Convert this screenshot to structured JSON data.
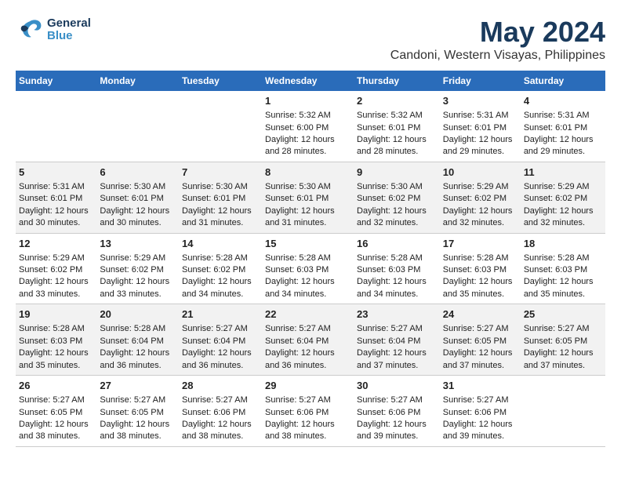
{
  "header": {
    "logo_general": "General",
    "logo_blue": "Blue",
    "main_title": "May 2024",
    "subtitle": "Candoni, Western Visayas, Philippines"
  },
  "days_of_week": [
    "Sunday",
    "Monday",
    "Tuesday",
    "Wednesday",
    "Thursday",
    "Friday",
    "Saturday"
  ],
  "weeks": [
    [
      {
        "day": "",
        "sunrise": "",
        "sunset": "",
        "daylight": ""
      },
      {
        "day": "",
        "sunrise": "",
        "sunset": "",
        "daylight": ""
      },
      {
        "day": "",
        "sunrise": "",
        "sunset": "",
        "daylight": ""
      },
      {
        "day": "1",
        "sunrise": "Sunrise: 5:32 AM",
        "sunset": "Sunset: 6:00 PM",
        "daylight": "Daylight: 12 hours and 28 minutes."
      },
      {
        "day": "2",
        "sunrise": "Sunrise: 5:32 AM",
        "sunset": "Sunset: 6:01 PM",
        "daylight": "Daylight: 12 hours and 28 minutes."
      },
      {
        "day": "3",
        "sunrise": "Sunrise: 5:31 AM",
        "sunset": "Sunset: 6:01 PM",
        "daylight": "Daylight: 12 hours and 29 minutes."
      },
      {
        "day": "4",
        "sunrise": "Sunrise: 5:31 AM",
        "sunset": "Sunset: 6:01 PM",
        "daylight": "Daylight: 12 hours and 29 minutes."
      }
    ],
    [
      {
        "day": "5",
        "sunrise": "Sunrise: 5:31 AM",
        "sunset": "Sunset: 6:01 PM",
        "daylight": "Daylight: 12 hours and 30 minutes."
      },
      {
        "day": "6",
        "sunrise": "Sunrise: 5:30 AM",
        "sunset": "Sunset: 6:01 PM",
        "daylight": "Daylight: 12 hours and 30 minutes."
      },
      {
        "day": "7",
        "sunrise": "Sunrise: 5:30 AM",
        "sunset": "Sunset: 6:01 PM",
        "daylight": "Daylight: 12 hours and 31 minutes."
      },
      {
        "day": "8",
        "sunrise": "Sunrise: 5:30 AM",
        "sunset": "Sunset: 6:01 PM",
        "daylight": "Daylight: 12 hours and 31 minutes."
      },
      {
        "day": "9",
        "sunrise": "Sunrise: 5:30 AM",
        "sunset": "Sunset: 6:02 PM",
        "daylight": "Daylight: 12 hours and 32 minutes."
      },
      {
        "day": "10",
        "sunrise": "Sunrise: 5:29 AM",
        "sunset": "Sunset: 6:02 PM",
        "daylight": "Daylight: 12 hours and 32 minutes."
      },
      {
        "day": "11",
        "sunrise": "Sunrise: 5:29 AM",
        "sunset": "Sunset: 6:02 PM",
        "daylight": "Daylight: 12 hours and 32 minutes."
      }
    ],
    [
      {
        "day": "12",
        "sunrise": "Sunrise: 5:29 AM",
        "sunset": "Sunset: 6:02 PM",
        "daylight": "Daylight: 12 hours and 33 minutes."
      },
      {
        "day": "13",
        "sunrise": "Sunrise: 5:29 AM",
        "sunset": "Sunset: 6:02 PM",
        "daylight": "Daylight: 12 hours and 33 minutes."
      },
      {
        "day": "14",
        "sunrise": "Sunrise: 5:28 AM",
        "sunset": "Sunset: 6:02 PM",
        "daylight": "Daylight: 12 hours and 34 minutes."
      },
      {
        "day": "15",
        "sunrise": "Sunrise: 5:28 AM",
        "sunset": "Sunset: 6:03 PM",
        "daylight": "Daylight: 12 hours and 34 minutes."
      },
      {
        "day": "16",
        "sunrise": "Sunrise: 5:28 AM",
        "sunset": "Sunset: 6:03 PM",
        "daylight": "Daylight: 12 hours and 34 minutes."
      },
      {
        "day": "17",
        "sunrise": "Sunrise: 5:28 AM",
        "sunset": "Sunset: 6:03 PM",
        "daylight": "Daylight: 12 hours and 35 minutes."
      },
      {
        "day": "18",
        "sunrise": "Sunrise: 5:28 AM",
        "sunset": "Sunset: 6:03 PM",
        "daylight": "Daylight: 12 hours and 35 minutes."
      }
    ],
    [
      {
        "day": "19",
        "sunrise": "Sunrise: 5:28 AM",
        "sunset": "Sunset: 6:03 PM",
        "daylight": "Daylight: 12 hours and 35 minutes."
      },
      {
        "day": "20",
        "sunrise": "Sunrise: 5:28 AM",
        "sunset": "Sunset: 6:04 PM",
        "daylight": "Daylight: 12 hours and 36 minutes."
      },
      {
        "day": "21",
        "sunrise": "Sunrise: 5:27 AM",
        "sunset": "Sunset: 6:04 PM",
        "daylight": "Daylight: 12 hours and 36 minutes."
      },
      {
        "day": "22",
        "sunrise": "Sunrise: 5:27 AM",
        "sunset": "Sunset: 6:04 PM",
        "daylight": "Daylight: 12 hours and 36 minutes."
      },
      {
        "day": "23",
        "sunrise": "Sunrise: 5:27 AM",
        "sunset": "Sunset: 6:04 PM",
        "daylight": "Daylight: 12 hours and 37 minutes."
      },
      {
        "day": "24",
        "sunrise": "Sunrise: 5:27 AM",
        "sunset": "Sunset: 6:05 PM",
        "daylight": "Daylight: 12 hours and 37 minutes."
      },
      {
        "day": "25",
        "sunrise": "Sunrise: 5:27 AM",
        "sunset": "Sunset: 6:05 PM",
        "daylight": "Daylight: 12 hours and 37 minutes."
      }
    ],
    [
      {
        "day": "26",
        "sunrise": "Sunrise: 5:27 AM",
        "sunset": "Sunset: 6:05 PM",
        "daylight": "Daylight: 12 hours and 38 minutes."
      },
      {
        "day": "27",
        "sunrise": "Sunrise: 5:27 AM",
        "sunset": "Sunset: 6:05 PM",
        "daylight": "Daylight: 12 hours and 38 minutes."
      },
      {
        "day": "28",
        "sunrise": "Sunrise: 5:27 AM",
        "sunset": "Sunset: 6:06 PM",
        "daylight": "Daylight: 12 hours and 38 minutes."
      },
      {
        "day": "29",
        "sunrise": "Sunrise: 5:27 AM",
        "sunset": "Sunset: 6:06 PM",
        "daylight": "Daylight: 12 hours and 38 minutes."
      },
      {
        "day": "30",
        "sunrise": "Sunrise: 5:27 AM",
        "sunset": "Sunset: 6:06 PM",
        "daylight": "Daylight: 12 hours and 39 minutes."
      },
      {
        "day": "31",
        "sunrise": "Sunrise: 5:27 AM",
        "sunset": "Sunset: 6:06 PM",
        "daylight": "Daylight: 12 hours and 39 minutes."
      },
      {
        "day": "",
        "sunrise": "",
        "sunset": "",
        "daylight": ""
      }
    ]
  ]
}
